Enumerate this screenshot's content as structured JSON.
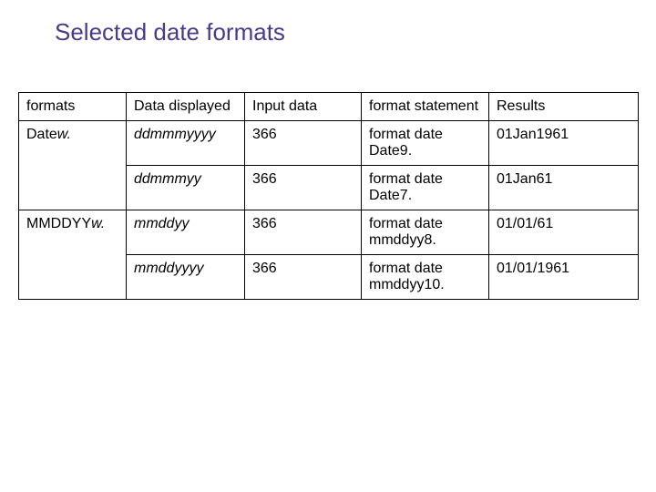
{
  "title": "Selected date formats",
  "headers": {
    "c1": "formats",
    "c2": "Data displayed",
    "c3": "Input data",
    "c4": "format statement",
    "c5": "Results"
  },
  "rows": [
    {
      "format_prefix": "Date",
      "format_suffix": "w.",
      "display": "ddmmmyyyy",
      "input": "366",
      "stmt": "format date Date9.",
      "result": "01Jan1961"
    },
    {
      "format_prefix": "",
      "format_suffix": "",
      "display": "ddmmmyy",
      "input": "366",
      "stmt": "format date Date7.",
      "result": "01Jan61"
    },
    {
      "format_prefix": "MMDDYY",
      "format_suffix": "w.",
      "display": "mmddyy",
      "input": "366",
      "stmt": "format date mmddyy8.",
      "result": "01/01/61"
    },
    {
      "format_prefix": "",
      "format_suffix": "",
      "display": "mmddyyyy",
      "input": "366",
      "stmt": "format date mmddyy10.",
      "result": "01/01/1961"
    }
  ]
}
